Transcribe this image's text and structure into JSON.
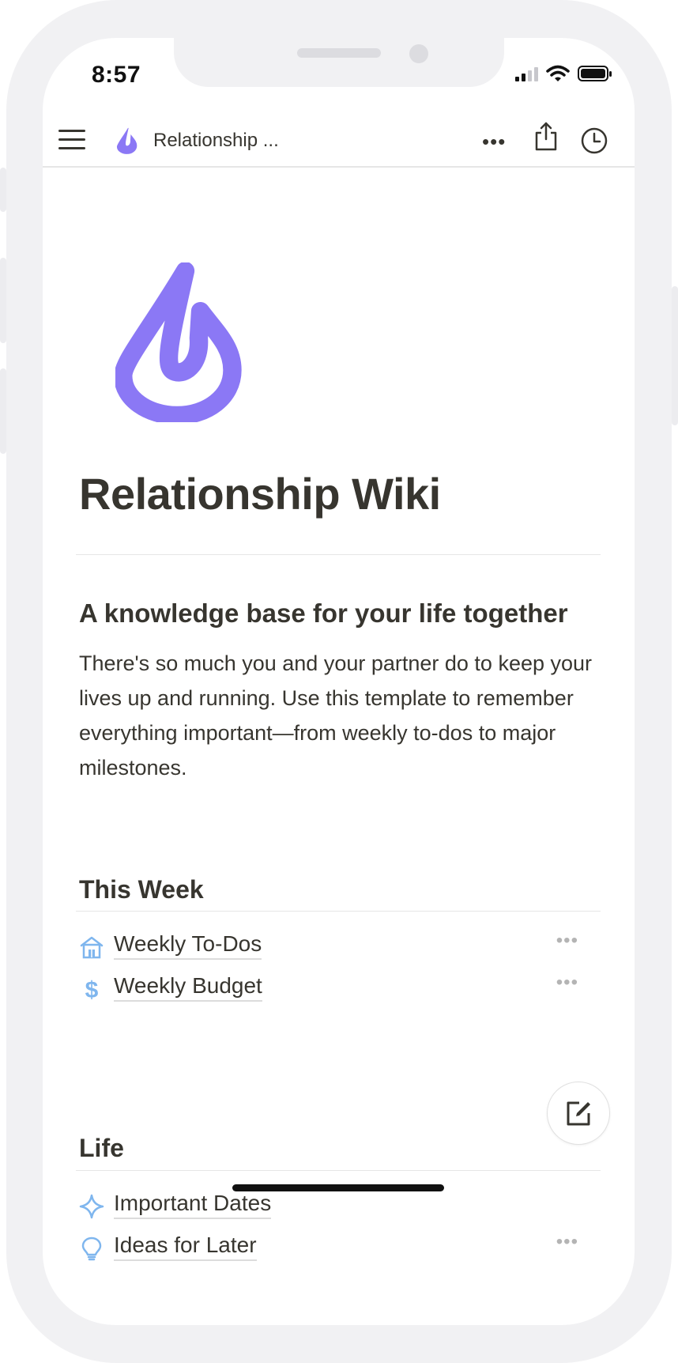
{
  "status_bar": {
    "time": "8:57"
  },
  "top_bar": {
    "breadcrumb": "Relationship ...",
    "more": "•••"
  },
  "page": {
    "title": "Relationship Wiki",
    "subheading": "A knowledge base for your life together",
    "description": "There's so much you and your partner do to keep your lives up and running. Use this template to remember everything important—from weekly to-dos to major milestones."
  },
  "sections": [
    {
      "title": "This Week",
      "items": [
        {
          "label": "Weekly To-Dos",
          "icon": "house-icon"
        },
        {
          "label": "Weekly Budget",
          "icon": "dollar-icon"
        }
      ]
    },
    {
      "title": "Life",
      "items": [
        {
          "label": "Important Dates",
          "icon": "sparkle-icon"
        },
        {
          "label": "Ideas for Later",
          "icon": "lightbulb-icon"
        }
      ]
    }
  ],
  "row_more": "•••",
  "colors": {
    "accent": "#8b78f5",
    "link_icon": "#7fb6ee",
    "text": "#37352f"
  }
}
